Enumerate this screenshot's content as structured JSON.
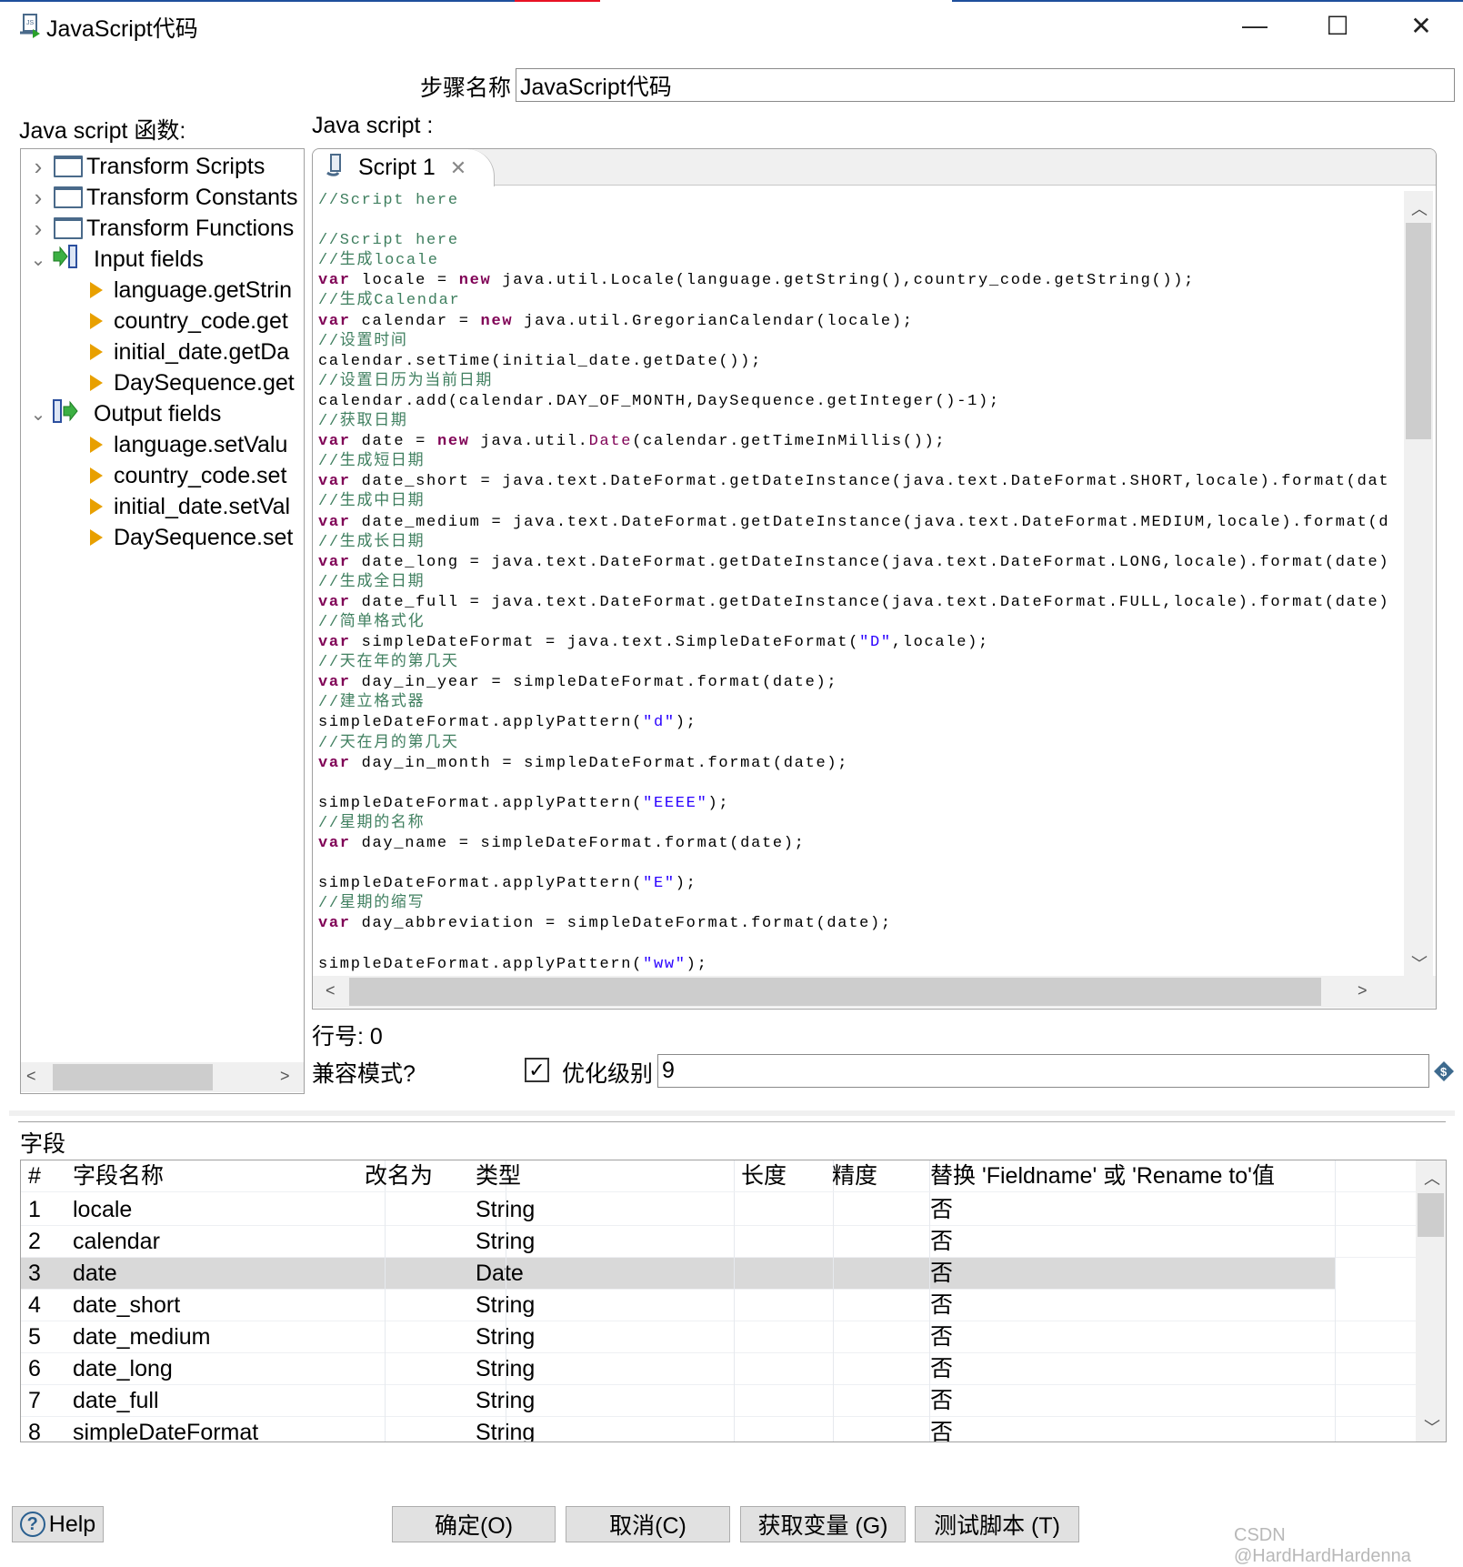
{
  "window": {
    "title": "JavaScript代码",
    "controls": {
      "minimize": "—",
      "maximize": "☐",
      "close": "✕"
    }
  },
  "step": {
    "label": "步骤名称",
    "value": "JavaScript代码"
  },
  "functions_label": "Java script 函数:",
  "script_label": "Java script :",
  "tree": {
    "items": [
      {
        "label": "Transform Scripts",
        "type": "folder",
        "expanded": false
      },
      {
        "label": "Transform Constants",
        "type": "folder",
        "expanded": false
      },
      {
        "label": "Transform Functions",
        "type": "folder",
        "expanded": false
      },
      {
        "label": "Input fields",
        "type": "input-group",
        "expanded": true
      },
      {
        "label": "language.getStrin",
        "type": "field"
      },
      {
        "label": "country_code.get",
        "type": "field"
      },
      {
        "label": "initial_date.getDa",
        "type": "field"
      },
      {
        "label": "DaySequence.get",
        "type": "field"
      },
      {
        "label": "Output fields",
        "type": "output-group",
        "expanded": true
      },
      {
        "label": "language.setValu",
        "type": "field"
      },
      {
        "label": "country_code.set",
        "type": "field"
      },
      {
        "label": "initial_date.setVal",
        "type": "field"
      },
      {
        "label": "DaySequence.set",
        "type": "field"
      }
    ]
  },
  "editor": {
    "tab_label": "Script 1",
    "code_lines": [
      [
        [
          "c",
          "//Script here"
        ]
      ],
      [],
      [
        [
          "c",
          "//Script here"
        ]
      ],
      [
        [
          "c",
          "//生成locale"
        ]
      ],
      [
        [
          "k",
          "var"
        ],
        [
          "t",
          " locale = "
        ],
        [
          "k",
          "new"
        ],
        [
          "t",
          " java.util.Locale(language.getString(),country_code.getString());"
        ]
      ],
      [
        [
          "c",
          "//生成Calendar"
        ]
      ],
      [
        [
          "k",
          "var"
        ],
        [
          "t",
          " calendar = "
        ],
        [
          "k",
          "new"
        ],
        [
          "t",
          " java.util.GregorianCalendar(locale);"
        ]
      ],
      [
        [
          "c",
          "//设置时间"
        ]
      ],
      [
        [
          "t",
          "calendar.setTime(initial_date.getDate());"
        ]
      ],
      [
        [
          "c",
          "//设置日历为当前日期"
        ]
      ],
      [
        [
          "t",
          "calendar.add(calendar.DAY_OF_MONTH,DaySequence.getInteger()-1);"
        ]
      ],
      [
        [
          "c",
          "//获取日期"
        ]
      ],
      [
        [
          "k",
          "var"
        ],
        [
          "t",
          " date = "
        ],
        [
          "k",
          "new"
        ],
        [
          "t",
          " java.util."
        ],
        [
          "f",
          "Date"
        ],
        [
          "t",
          "(calendar.getTimeInMillis());"
        ]
      ],
      [
        [
          "c",
          "//生成短日期"
        ]
      ],
      [
        [
          "k",
          "var"
        ],
        [
          "t",
          " date_short = java.text.DateFormat.getDateInstance(java.text.DateFormat.SHORT,locale).format(dat"
        ]
      ],
      [
        [
          "c",
          "//生成中日期"
        ]
      ],
      [
        [
          "k",
          "var"
        ],
        [
          "t",
          " date_medium = java.text.DateFormat.getDateInstance(java.text.DateFormat.MEDIUM,locale).format(d"
        ]
      ],
      [
        [
          "c",
          "//生成长日期"
        ]
      ],
      [
        [
          "k",
          "var"
        ],
        [
          "t",
          " date_long = java.text.DateFormat.getDateInstance(java.text.DateFormat.LONG,locale).format(date)"
        ]
      ],
      [
        [
          "c",
          "//生成全日期"
        ]
      ],
      [
        [
          "k",
          "var"
        ],
        [
          "t",
          " date_full = java.text.DateFormat.getDateInstance(java.text.DateFormat.FULL,locale).format(date)"
        ]
      ],
      [
        [
          "c",
          "//简单格式化"
        ]
      ],
      [
        [
          "k",
          "var"
        ],
        [
          "t",
          " simpleDateFormat = java.text.SimpleDateFormat("
        ],
        [
          "s",
          "\"D\""
        ],
        [
          "t",
          ",locale);"
        ]
      ],
      [
        [
          "c",
          "//天在年的第几天"
        ]
      ],
      [
        [
          "k",
          "var"
        ],
        [
          "t",
          " day_in_year = simpleDateFormat.format(date);"
        ]
      ],
      [
        [
          "c",
          "//建立格式器"
        ]
      ],
      [
        [
          "t",
          "simpleDateFormat.applyPattern("
        ],
        [
          "s",
          "\"d\""
        ],
        [
          "t",
          ");"
        ]
      ],
      [
        [
          "c",
          "//天在月的第几天"
        ]
      ],
      [
        [
          "k",
          "var"
        ],
        [
          "t",
          " day_in_month = simpleDateFormat.format(date);"
        ]
      ],
      [],
      [
        [
          "t",
          "simpleDateFormat.applyPattern("
        ],
        [
          "s",
          "\"EEEE\""
        ],
        [
          "t",
          ");"
        ]
      ],
      [
        [
          "c",
          "//星期的名称"
        ]
      ],
      [
        [
          "k",
          "var"
        ],
        [
          "t",
          " day_name = simpleDateFormat.format(date);"
        ]
      ],
      [],
      [
        [
          "t",
          "simpleDateFormat.applyPattern("
        ],
        [
          "s",
          "\"E\""
        ],
        [
          "t",
          ");"
        ]
      ],
      [
        [
          "c",
          "//星期的缩写"
        ]
      ],
      [
        [
          "k",
          "var"
        ],
        [
          "t",
          " day_abbreviation = simpleDateFormat.format(date);"
        ]
      ],
      [],
      [
        [
          "t",
          "simpleDateFormat.applyPattern("
        ],
        [
          "s",
          "\"ww\""
        ],
        [
          "t",
          ");"
        ]
      ]
    ]
  },
  "line_number": "行号: 0",
  "compat_mode": {
    "label": "兼容模式?",
    "checked": true
  },
  "optimization": {
    "label": "优化级别",
    "value": "9"
  },
  "fields": {
    "section_label": "字段",
    "columns": [
      "#",
      "字段名称",
      "改名为",
      "类型",
      "长度",
      "精度",
      "替换 'Fieldname' 或 'Rename to'值"
    ],
    "rows": [
      [
        "1",
        "locale",
        "",
        "String",
        "",
        "",
        "否"
      ],
      [
        "2",
        "calendar",
        "",
        "String",
        "",
        "",
        "否"
      ],
      [
        "3",
        "date",
        "",
        "Date",
        "",
        "",
        "否"
      ],
      [
        "4",
        "date_short",
        "",
        "String",
        "",
        "",
        "否"
      ],
      [
        "5",
        "date_medium",
        "",
        "String",
        "",
        "",
        "否"
      ],
      [
        "6",
        "date_long",
        "",
        "String",
        "",
        "",
        "否"
      ],
      [
        "7",
        "date_full",
        "",
        "String",
        "",
        "",
        "否"
      ],
      [
        "8",
        "simpleDateFormat",
        "",
        "String",
        "",
        "",
        "否"
      ]
    ],
    "selected_row": 3
  },
  "buttons": {
    "help": "Help",
    "ok": "确定(O)",
    "cancel": "取消(C)",
    "get_vars": "获取变量 (G)",
    "test": "测试脚本 (T)"
  },
  "watermark": "CSDN @HardHardHardenna",
  "colors": {
    "keyword": "#7f0055",
    "comment": "#3f7f5f",
    "string": "#2a00ff",
    "selection": "#d9d9d9"
  }
}
